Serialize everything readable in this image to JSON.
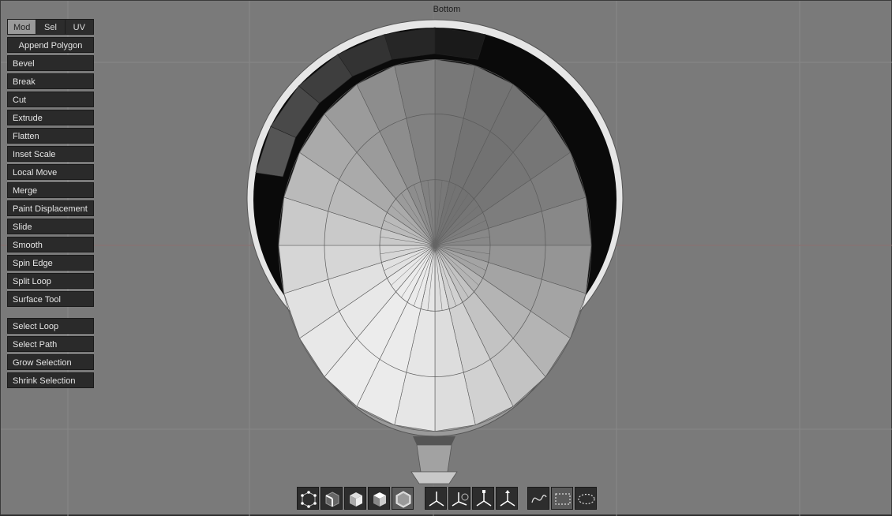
{
  "viewport": {
    "title": "Bottom",
    "background": "#7a7a7a"
  },
  "tabs": [
    {
      "label": "Mod",
      "active": true
    },
    {
      "label": "Sel",
      "active": false
    },
    {
      "label": "UV",
      "active": false
    }
  ],
  "modeling_tools": [
    "Append Polygon",
    "Bevel",
    "Break",
    "Cut",
    "Extrude",
    "Flatten",
    "Inset Scale",
    "Local Move",
    "Merge",
    "Paint Displacement",
    "Slide",
    "Smooth",
    "Spin Edge",
    "Split Loop",
    "Surface Tool"
  ],
  "selection_tools": [
    "Select Loop",
    "Select Path",
    "Grow Selection",
    "Shrink Selection"
  ],
  "toolbar": {
    "component_modes": [
      "vertex-mode-icon",
      "edge-mode-icon",
      "face-mode-icon",
      "object-mode-icon",
      "shaded-cube-icon"
    ],
    "transform_modes": [
      "transform-axis-icon",
      "move-axis-icon",
      "rotate-axis-icon",
      "scale-axis-icon"
    ],
    "selection_modes": [
      "lasso-select-icon",
      "rectangle-select-icon",
      "ellipse-select-icon"
    ]
  }
}
